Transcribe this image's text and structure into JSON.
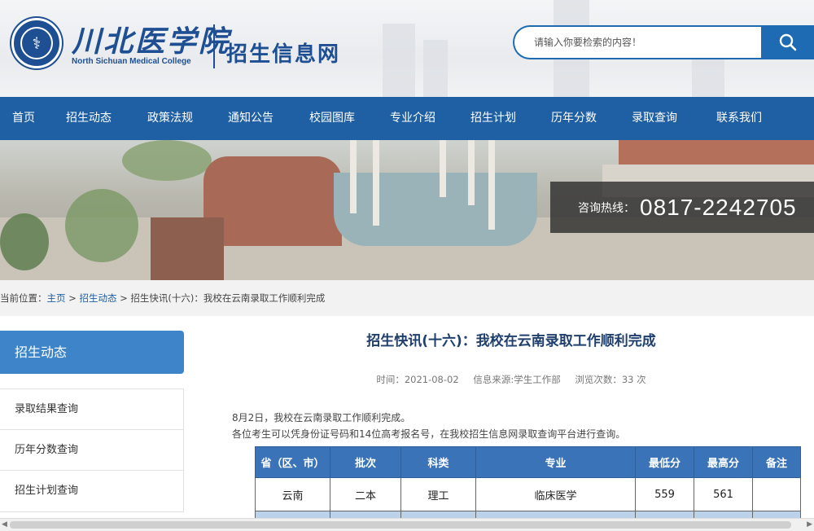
{
  "header": {
    "logo_cn": "川北医学院",
    "logo_en": "North Sichuan Medical College",
    "site_name": "招生信息网",
    "search_placeholder": "请输入你要检索的内容！",
    "search_icon": "search-icon"
  },
  "nav": {
    "items": [
      "首页",
      "招生动态",
      "政策法规",
      "通知公告",
      "校园图库",
      "专业介绍",
      "招生计划",
      "历年分数",
      "录取查询",
      "联系我们"
    ]
  },
  "banner": {
    "hotline_label": "咨询热线：",
    "hotline_number": "0817-2242705"
  },
  "breadcrumb": {
    "prefix": "当前位置：",
    "home": "主页",
    "sep": " > ",
    "section": "招生动态",
    "current": "招生快讯(十六)：我校在云南录取工作顺利完成"
  },
  "sidebar": {
    "title": "招生动态",
    "items": [
      "录取结果查询",
      "历年分数查询",
      "招生计划查询"
    ]
  },
  "article": {
    "title": "招生快讯(十六)：我校在云南录取工作顺利完成",
    "time": "时间：2021-08-02",
    "source": "信息来源:学生工作部",
    "views": "浏览次数：33 次",
    "para1": "8月2日，我校在云南录取工作顺利完成。",
    "para2": "各位考生可以凭身份证号码和14位高考报名号，在我校招生信息网录取查询平台进行查询。"
  },
  "table": {
    "headers": [
      "省（区、市）",
      "批次",
      "科类",
      "专业",
      "最低分",
      "最高分",
      "备注"
    ],
    "rows": [
      [
        "云南",
        "二本",
        "理工",
        "临床医学",
        "559",
        "561",
        ""
      ]
    ]
  },
  "colors": {
    "primary": "#1f5fa3",
    "sidebar_head": "#3d84c8",
    "table_header": "#3a73b8"
  }
}
